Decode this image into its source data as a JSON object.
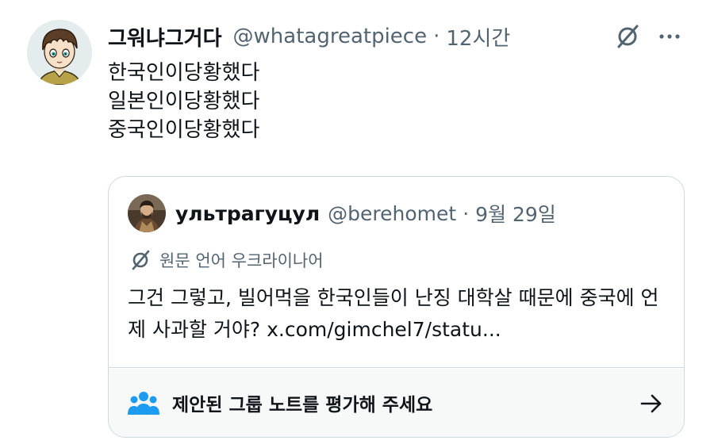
{
  "post": {
    "display_name": "그워냐그거다",
    "handle": "@whatagreatpiece",
    "separator": "·",
    "time": "12시간",
    "lines": [
      "한국인이당황했다",
      "일본인이당황했다",
      "중국인이당황했다"
    ],
    "icons": {
      "avatar": "anime-boy-avatar",
      "translate": "translate-slash-icon",
      "more": "more-dots-icon"
    }
  },
  "quote": {
    "display_name": "ультрагуцул",
    "handle": "@berehomet",
    "separator": "·",
    "time": "9월 29일",
    "language_note": "원문 언어 우크라이나어",
    "text": "그건 그렇고, 빌어먹을 한국인들이 난징 대학살 때문에 중국에 언제 사과할 거야? x.com/gimchel7/statu...",
    "icons": {
      "avatar": "photo-avatar",
      "language": "translate-slash-icon"
    }
  },
  "community_notes": {
    "label": "제안된 그룹 노트를 평가해 주세요",
    "icons": {
      "people": "people-group-icon",
      "arrow": "arrow-right-icon"
    },
    "accent_color": "#1d9bf0"
  },
  "colors": {
    "text_primary": "#0f1419",
    "text_secondary": "#536471",
    "border": "#cfd9de",
    "footer_bg": "#f7f9f9"
  }
}
